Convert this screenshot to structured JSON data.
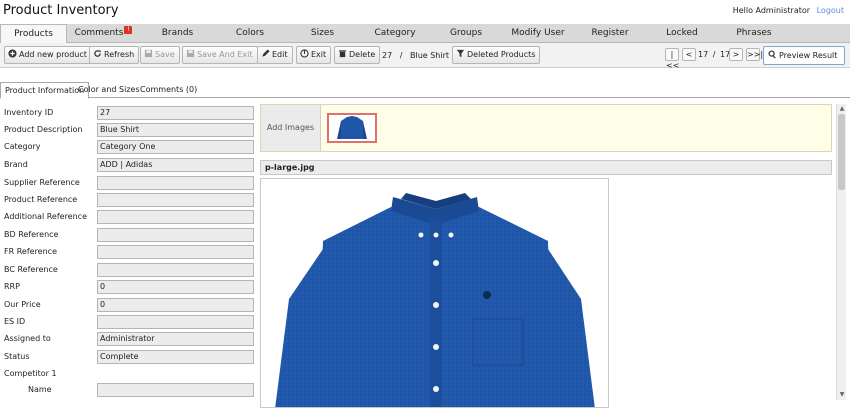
{
  "app": {
    "title": "Product Inventory",
    "greeting": "Hello Administrator",
    "logout": "Logout"
  },
  "tabs": [
    {
      "label": "Products",
      "active": true
    },
    {
      "label": "Comments",
      "badge": "!"
    },
    {
      "label": "Brands"
    },
    {
      "label": "Colors"
    },
    {
      "label": "Sizes"
    },
    {
      "label": "Category"
    },
    {
      "label": "Groups"
    },
    {
      "label": "Modify User"
    },
    {
      "label": "Register"
    },
    {
      "label": "Locked Products"
    },
    {
      "label": "Phrases"
    }
  ],
  "toolbar": {
    "add_new": "Add new product",
    "refresh": "Refresh",
    "save": "Save",
    "save_exit": "Save And Exit",
    "edit": "Edit",
    "exit": "Exit",
    "delete": "Delete",
    "record_id": "27",
    "record_separator": "/",
    "record_name": "Blue Shirt",
    "deleted_products": "Deleted Products",
    "nav_first": "|<<",
    "nav_prev": "<",
    "nav_next": ">",
    "nav_last": ">>|",
    "page_current": "17",
    "page_separator": "/",
    "page_total": "17",
    "preview": "Preview Result"
  },
  "subtabs": [
    {
      "label": "Product Information",
      "active": true
    },
    {
      "label": "Color and Sizes"
    },
    {
      "label": "Comments (0)"
    }
  ],
  "form": {
    "inventory_id": {
      "label": "Inventory ID",
      "value": "27"
    },
    "product_description": {
      "label": "Product Description",
      "value": "Blue Shirt"
    },
    "category": {
      "label": "Category",
      "value": "Category One"
    },
    "brand": {
      "label": "Brand",
      "value": "ADD | Adidas"
    },
    "supplier_reference": {
      "label": "Supplier Reference",
      "value": ""
    },
    "product_reference": {
      "label": "Product Reference",
      "value": ""
    },
    "additional_reference": {
      "label": "Additional Reference",
      "value": ""
    },
    "bd_reference": {
      "label": "BD Reference",
      "value": ""
    },
    "fr_reference": {
      "label": "FR Reference",
      "value": ""
    },
    "bc_reference": {
      "label": "BC Reference",
      "value": ""
    },
    "rrp": {
      "label": "RRP",
      "value": "0"
    },
    "our_price": {
      "label": "Our Price",
      "value": "0"
    },
    "es_id": {
      "label": "ES ID",
      "value": ""
    },
    "assigned_to": {
      "label": "Assigned to",
      "value": "Administrator"
    },
    "status": {
      "label": "Status",
      "value": "Complete"
    },
    "competitor_1": {
      "label": "Competitor 1"
    },
    "competitor_name": {
      "label": "Name",
      "value": ""
    }
  },
  "images": {
    "add_label": "Add Images",
    "current_file": "p-large.jpg"
  },
  "colors": {
    "accent": "#5a8fd0",
    "shirt": "#1f56a8",
    "badge": "#d9332b"
  }
}
